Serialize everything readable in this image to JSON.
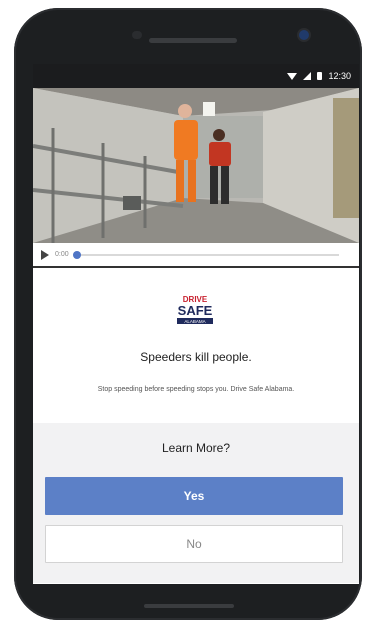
{
  "status_bar": {
    "time": "12:30",
    "icons": [
      "wifi-icon",
      "signal-icon",
      "battery-icon"
    ]
  },
  "video": {
    "current_time": "0:00",
    "progress": 0.0,
    "scene": "video-thumbnail"
  },
  "logo": {
    "line1": "DRIVE",
    "line2": "SAFE",
    "line3": "ALABAMA"
  },
  "message": {
    "headline": "Speeders kill people.",
    "subtext": "Stop speeding before speeding stops you. Drive Safe Alabama."
  },
  "cta": {
    "question": "Learn More?",
    "yes_label": "Yes",
    "no_label": "No"
  },
  "colors": {
    "accent": "#5c80c7",
    "phone_body": "#1d1f21",
    "cta_background": "#f2f2f3"
  }
}
